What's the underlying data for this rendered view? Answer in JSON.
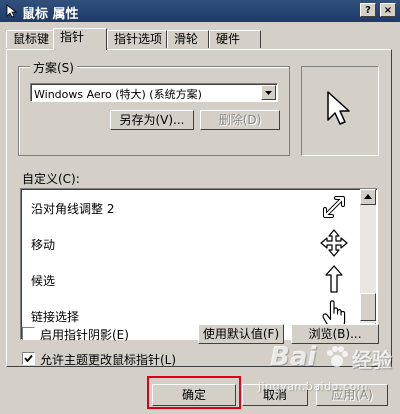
{
  "window": {
    "title": "鼠标 属性",
    "help_label": "?",
    "close_label": "×"
  },
  "tabs": [
    {
      "label": "鼠标键",
      "active": false
    },
    {
      "label": "指针",
      "active": true
    },
    {
      "label": "指针选项",
      "active": false
    },
    {
      "label": "滑轮",
      "active": false
    },
    {
      "label": "硬件",
      "active": false
    }
  ],
  "scheme": {
    "group_label": "方案(S)",
    "selected": "Windows Aero (特大) (系统方案)",
    "save_as_label": "另存为(V)...",
    "delete_label": "删除(D)"
  },
  "preview": {
    "icon": "arrow-pointer-icon"
  },
  "customize": {
    "label": "自定义(C):",
    "items": [
      {
        "label": "沿对角线调整 2",
        "icon": "diagonal-resize-icon"
      },
      {
        "label": "移动",
        "icon": "move-icon"
      },
      {
        "label": "候选",
        "icon": "up-arrow-icon"
      },
      {
        "label": "链接选择",
        "icon": "hand-pointer-icon"
      }
    ]
  },
  "options": {
    "shadow": {
      "label": "启用指针阴影(E)",
      "checked": false
    },
    "theme": {
      "label": "允许主题更改鼠标指针(L)",
      "checked": true
    },
    "default_label": "使用默认值(F)",
    "browse_label": "浏览(B)..."
  },
  "footer": {
    "ok_label": "确定",
    "cancel_label": "取消",
    "apply_label": "应用(A)"
  },
  "watermark": {
    "brand": "Bai",
    "brand2": "经验",
    "url": "jingyan.baidu.com"
  },
  "colors": {
    "titlebar": "#1d3a68",
    "dialog": "#d4d0c8",
    "highlight": "#e0001a"
  }
}
